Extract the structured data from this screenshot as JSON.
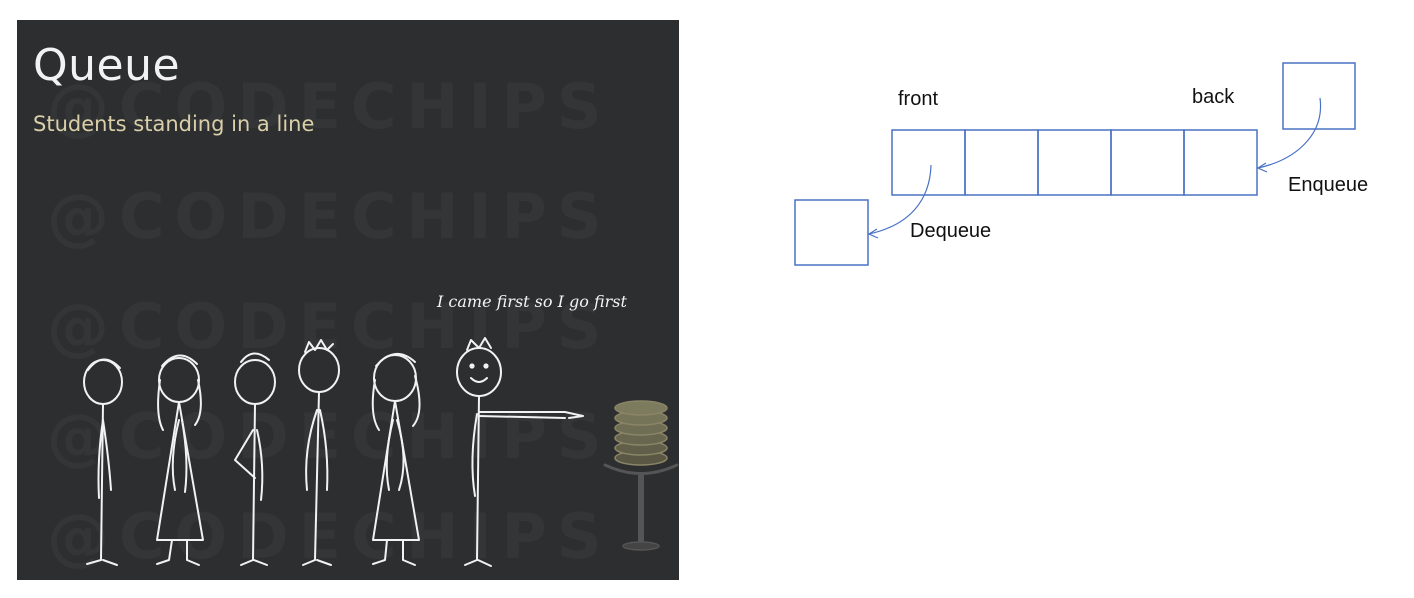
{
  "slide": {
    "title": "Queue",
    "subtitle": "Students standing in a line",
    "speech": "I came first so I go first",
    "watermark": "@CODECHIPS",
    "background": "#2d2e30",
    "title_color": "#f2f2f2",
    "subtitle_color": "#d9cfa9"
  },
  "diagram": {
    "front_label": "front",
    "back_label": "back",
    "enqueue_label": "Enqueue",
    "dequeue_label": "Dequeue",
    "cell_count": 5,
    "line_color": "#4a72c4"
  }
}
